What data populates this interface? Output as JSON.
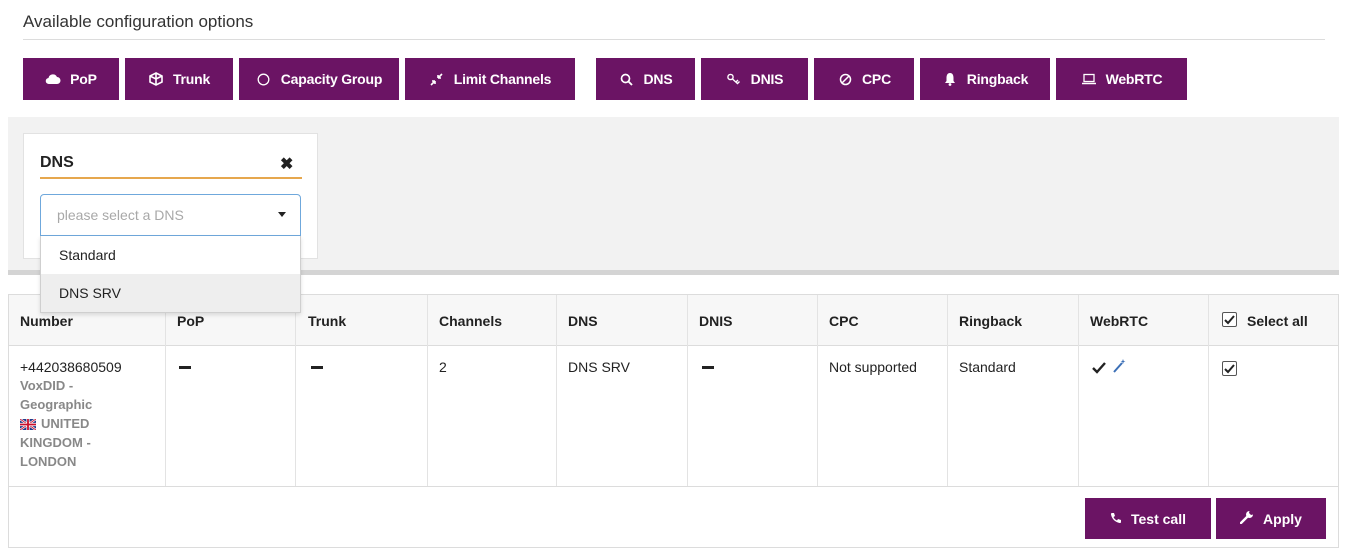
{
  "header": {
    "title": "Available configuration options"
  },
  "options": [
    {
      "label": "PoP",
      "icon": "cloud-icon"
    },
    {
      "label": "Trunk",
      "icon": "cube-icon"
    },
    {
      "label": "Capacity Group",
      "icon": "circle-icon"
    },
    {
      "label": "Limit Channels",
      "icon": "compress-icon"
    },
    {
      "label": "DNS",
      "icon": "search-icon"
    },
    {
      "label": "DNIS",
      "icon": "key-icon"
    },
    {
      "label": "CPC",
      "icon": "ban-icon"
    },
    {
      "label": "Ringback",
      "icon": "bell-icon"
    },
    {
      "label": "WebRTC",
      "icon": "laptop-icon"
    }
  ],
  "dns_card": {
    "title": "DNS",
    "close_symbol": "✖",
    "select_placeholder": "please select a DNS",
    "dropdown_options": [
      "Standard",
      "DNS SRV"
    ],
    "highlighted_option": "DNS SRV"
  },
  "table": {
    "headers": [
      "Number",
      "PoP",
      "Trunk",
      "Channels",
      "DNS",
      "DNIS",
      "CPC",
      "Ringback",
      "WebRTC",
      "Select all"
    ],
    "select_all_checked": true,
    "rows": [
      {
        "number": "+442038680509",
        "provider": "VoxDID -",
        "type": "Geographic",
        "country": "UNITED",
        "country2": "KINGDOM -",
        "city": "LONDON",
        "pop": "—",
        "trunk": "—",
        "channels": "2",
        "dns": "DNS SRV",
        "dnis": "—",
        "cpc": "Not supported",
        "ringback": "Standard",
        "webrtc_enabled": true,
        "selected": true
      }
    ]
  },
  "actions": {
    "test_call_label": "Test call",
    "apply_label": "Apply"
  },
  "colors": {
    "accent": "#6b1464",
    "focus_border": "#6fa8dc",
    "underline": "#e6a74d",
    "panel_bg": "#f2f2f2"
  }
}
